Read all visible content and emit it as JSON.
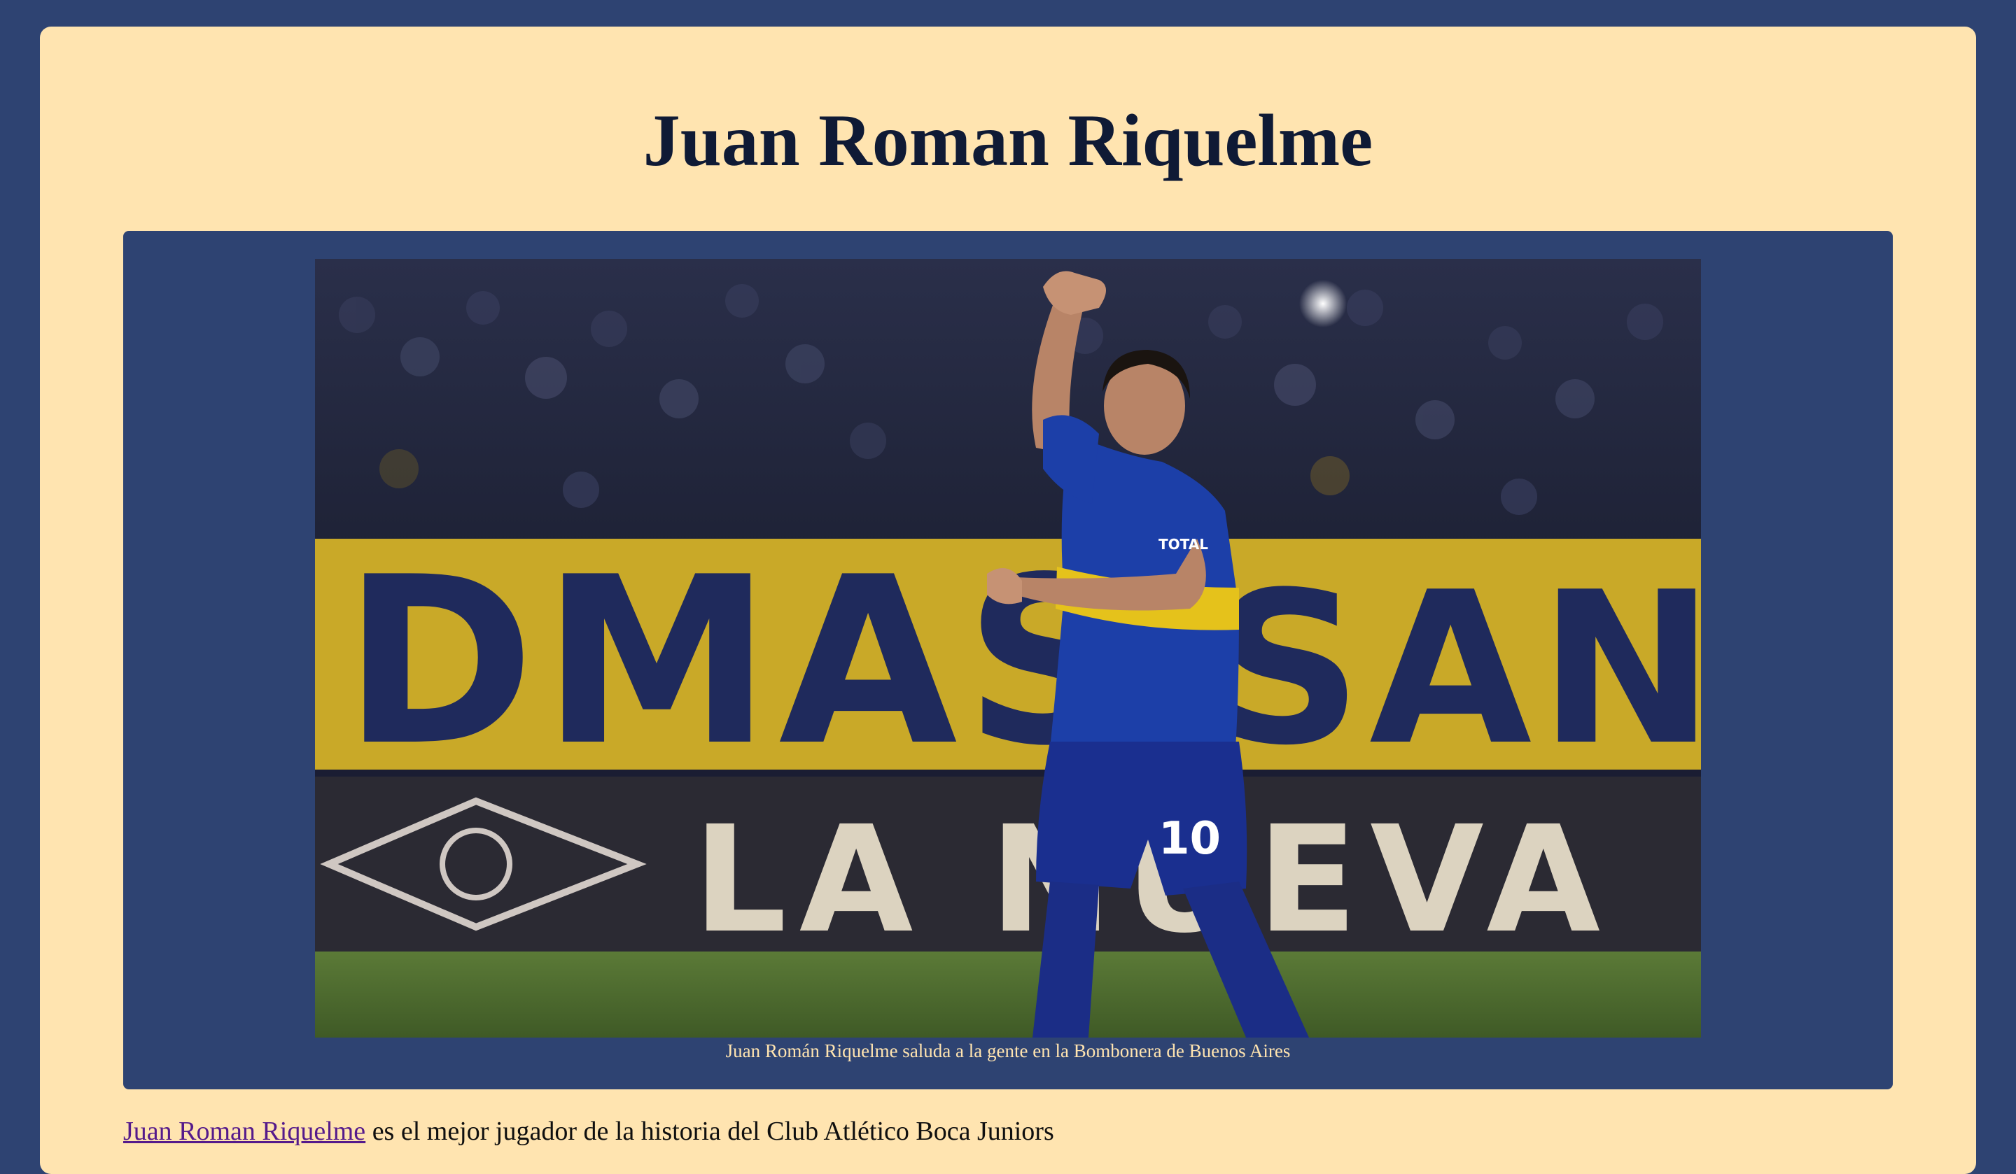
{
  "page": {
    "title": "Juan Roman Riquelme",
    "background_color": "#2e4372",
    "card_color": "#ffe4b0"
  },
  "figure": {
    "caption": "Juan Román Riquelme saluda a la gente en la Bombonera de Buenos Aires",
    "banner_text_top": "DMAS",
    "banner_text_top_right": "SAN",
    "banner_text_bottom": "LA NUEVA",
    "shirt_number": "10",
    "sponsor_text": "TOTAL"
  },
  "intro": {
    "link_text": "Juan Roman Riquelme",
    "text": " es el mejor jugador de la historia del Club Atlético Boca Juniors",
    "link_color": "#551a8b"
  }
}
